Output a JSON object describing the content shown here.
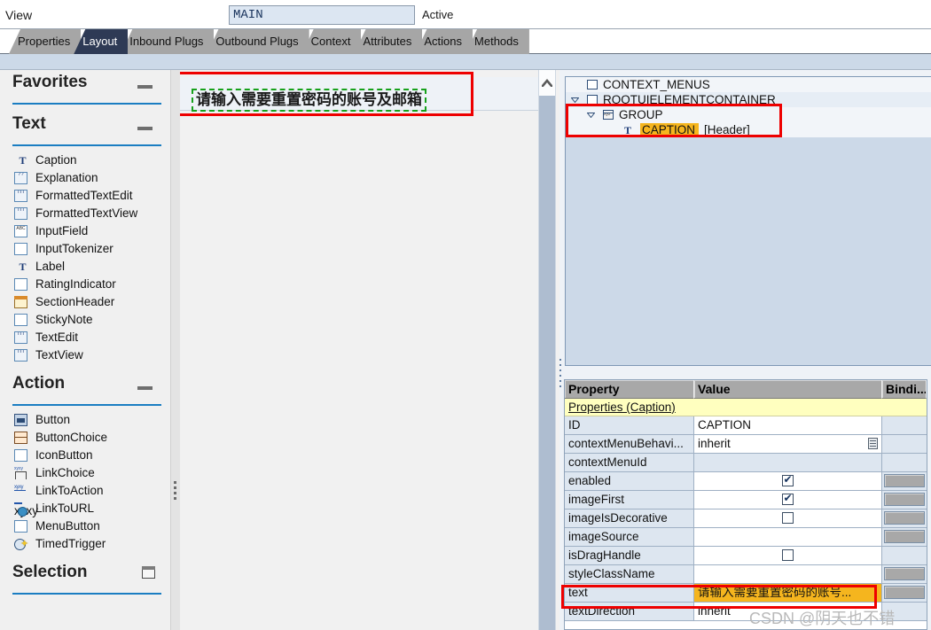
{
  "viewbar": {
    "label": "View",
    "name_value": "MAIN",
    "status": "Active"
  },
  "tabs": [
    {
      "label": "Properties",
      "active": false
    },
    {
      "label": "Layout",
      "active": true
    },
    {
      "label": "Inbound Plugs",
      "active": false
    },
    {
      "label": "Outbound Plugs",
      "active": false
    },
    {
      "label": "Context",
      "active": false
    },
    {
      "label": "Attributes",
      "active": false
    },
    {
      "label": "Actions",
      "active": false
    },
    {
      "label": "Methods",
      "active": false
    }
  ],
  "sidebar": {
    "sections": [
      {
        "title": "Favorites",
        "collapse_icon": "minus",
        "items": []
      },
      {
        "title": "Text",
        "collapse_icon": "minus",
        "items": [
          {
            "label": "Caption",
            "icon": "t-letter-icon"
          },
          {
            "label": "Explanation",
            "icon": "question-grid-icon"
          },
          {
            "label": "FormattedTextEdit",
            "icon": "text-grid-icon"
          },
          {
            "label": "FormattedTextView",
            "icon": "text-grid-icon"
          },
          {
            "label": "InputField",
            "icon": "input-field-icon"
          },
          {
            "label": "InputTokenizer",
            "icon": "box-icon"
          },
          {
            "label": "Label",
            "icon": "t-letter-icon"
          },
          {
            "label": "RatingIndicator",
            "icon": "box-icon"
          },
          {
            "label": "SectionHeader",
            "icon": "note-icon"
          },
          {
            "label": "StickyNote",
            "icon": "box-icon"
          },
          {
            "label": "TextEdit",
            "icon": "text-grid-icon"
          },
          {
            "label": "TextView",
            "icon": "text-grid-icon"
          }
        ]
      },
      {
        "title": "Action",
        "collapse_icon": "minus",
        "items": [
          {
            "label": "Button",
            "icon": "button-icon"
          },
          {
            "label": "ButtonChoice",
            "icon": "button-choice-icon"
          },
          {
            "label": "IconButton",
            "icon": "box-icon"
          },
          {
            "label": "LinkChoice",
            "icon": "link-choice-icon"
          },
          {
            "label": "LinkToAction",
            "icon": "link-icon"
          },
          {
            "label": "LinkToURL",
            "icon": "globe-link-icon"
          },
          {
            "label": "MenuButton",
            "icon": "box-icon"
          },
          {
            "label": "TimedTrigger",
            "icon": "clock-icon"
          }
        ]
      },
      {
        "title": "Selection",
        "collapse_icon": "square",
        "items": []
      }
    ]
  },
  "canvas": {
    "caption_text": "请输入需要重置密码的账号及邮箱",
    "selection_color": "#17a11b",
    "highlight_box_color": "#ee0000"
  },
  "tree": {
    "rows": [
      {
        "label": "CONTEXT_MENUS",
        "indent": 24,
        "arrow": false,
        "icon": "box-icon",
        "selected": false,
        "suffix": ""
      },
      {
        "label": "ROOTUIELEMENTCONTAINER",
        "indent": 24,
        "arrow": true,
        "icon": "box-icon",
        "selected": false,
        "suffix": ""
      },
      {
        "label": "GROUP",
        "indent": 42,
        "arrow": true,
        "icon": "group-icon",
        "selected": false,
        "suffix": ""
      },
      {
        "label": "CAPTION",
        "indent": 66,
        "arrow": false,
        "icon": "t-letter-icon",
        "selected": true,
        "suffix": "[Header]"
      }
    ]
  },
  "properties": {
    "columns": [
      "Property",
      "Value",
      "Bindi..."
    ],
    "group_label": "Properties (Caption)",
    "rows": [
      {
        "name": "ID",
        "value": "CAPTION",
        "kind": "text",
        "bind_button": false
      },
      {
        "name": "contextMenuBehavi...",
        "value": "inherit",
        "kind": "dropdown",
        "bind_button": false
      },
      {
        "name": "contextMenuId",
        "value": "",
        "kind": "empty",
        "bind_button": false
      },
      {
        "name": "enabled",
        "value": "checked",
        "kind": "checkbox",
        "bind_button": true
      },
      {
        "name": "imageFirst",
        "value": "checked",
        "kind": "checkbox",
        "bind_button": true
      },
      {
        "name": "imageIsDecorative",
        "value": "unchecked",
        "kind": "checkbox",
        "bind_button": true
      },
      {
        "name": "imageSource",
        "value": "",
        "kind": "text",
        "bind_button": true
      },
      {
        "name": "isDragHandle",
        "value": "unchecked",
        "kind": "checkbox",
        "bind_button": false
      },
      {
        "name": "styleClassName",
        "value": "",
        "kind": "text",
        "bind_button": true
      },
      {
        "name": "text",
        "value": "请输入需要重置密码的账号...",
        "kind": "highlight",
        "bind_button": true
      },
      {
        "name": "textDirection",
        "value": "inherit",
        "kind": "text",
        "bind_button": false
      }
    ]
  },
  "watermark": {
    "text": "CSDN @阴天也不错"
  },
  "scrollbar": {
    "up_arrow_icon": "chevron-up-icon"
  }
}
